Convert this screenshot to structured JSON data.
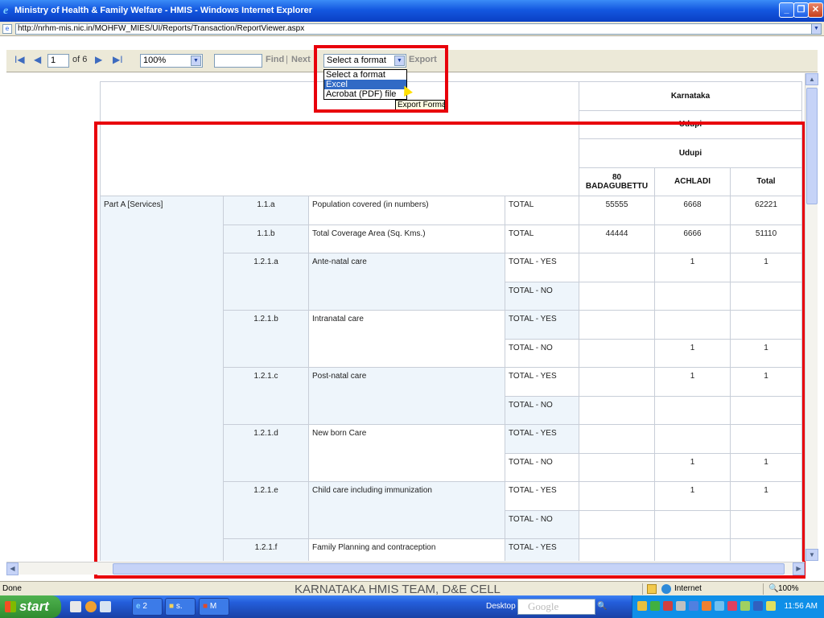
{
  "window": {
    "title": "Ministry of Health & Family Welfare - HMIS - Windows Internet Explorer",
    "url": "http://nrhm-mis.nic.in/MOHFW_MIES/UI/Reports/Transaction/ReportViewer.aspx"
  },
  "toolbar": {
    "first_page": "I◀",
    "prev_page": "◀",
    "page_value": "1",
    "page_of": "of 6",
    "next_page": "▶",
    "last_page": "▶I",
    "zoom": "100%",
    "find_value": "",
    "find_label": "Find",
    "separator": "|",
    "next_label": "Next",
    "format_selected": "Select a format",
    "export_label": "Export"
  },
  "format_dropdown": {
    "options": [
      "Select a format",
      "Excel",
      "Acrobat (PDF) file"
    ],
    "highlighted_index": 1,
    "tooltip": "Export Format"
  },
  "report": {
    "header": {
      "state": "Karnataka",
      "district_row1": "Udupi",
      "district_row2": "Udupi",
      "columns": [
        "80 BADAGUBETTU",
        "ACHLADI",
        "Total"
      ]
    },
    "section_label": "Part A [Services]",
    "rows": [
      {
        "code": "1.1.a",
        "item": "Population covered (in numbers)",
        "type": "TOTAL",
        "v1": "55555",
        "v2": "6668",
        "total": "62221"
      },
      {
        "code": "1.1.b",
        "item": "Total Coverage Area (Sq. Kms.)",
        "type": "TOTAL",
        "v1": "44444",
        "v2": "6666",
        "total": "51110"
      },
      {
        "code": "1.2.1.a",
        "item": "Ante-natal care",
        "type": "TOTAL - YES",
        "v1": "",
        "v2": "1",
        "total": "1"
      },
      {
        "code": "",
        "item": "",
        "type": "TOTAL - NO",
        "v1": "",
        "v2": "",
        "total": ""
      },
      {
        "code": "1.2.1.b",
        "item": "Intranatal care",
        "type": "TOTAL - YES",
        "v1": "",
        "v2": "",
        "total": ""
      },
      {
        "code": "",
        "item": "",
        "type": "TOTAL - NO",
        "v1": "",
        "v2": "1",
        "total": "1"
      },
      {
        "code": "1.2.1.c",
        "item": "Post-natal care",
        "type": "TOTAL - YES",
        "v1": "",
        "v2": "1",
        "total": "1"
      },
      {
        "code": "",
        "item": "",
        "type": "TOTAL - NO",
        "v1": "",
        "v2": "",
        "total": ""
      },
      {
        "code": "1.2.1.d",
        "item": "New born Care",
        "type": "TOTAL - YES",
        "v1": "",
        "v2": "",
        "total": ""
      },
      {
        "code": "",
        "item": "",
        "type": "TOTAL - NO",
        "v1": "",
        "v2": "1",
        "total": "1"
      },
      {
        "code": "1.2.1.e",
        "item": "Child care including immunization",
        "type": "TOTAL - YES",
        "v1": "",
        "v2": "1",
        "total": "1"
      },
      {
        "code": "",
        "item": "",
        "type": "TOTAL - NO",
        "v1": "",
        "v2": "",
        "total": ""
      },
      {
        "code": "1.2.1.f",
        "item": "Family Planning and contraception",
        "type": "TOTAL - YES",
        "v1": "",
        "v2": "",
        "total": ""
      }
    ]
  },
  "statusbar": {
    "status": "Done",
    "zone": "Internet",
    "zoom": "100%",
    "caption": "KARNATAKA HMIS TEAM, D&E CELL"
  },
  "taskbar": {
    "start": "start",
    "ie_group": "2",
    "task1": "s.",
    "task2": "M",
    "desktop": "Desktop",
    "search_placeholder": "Google",
    "clock": "11:56 AM"
  },
  "colors": {
    "highlight": "#e8000b",
    "selection": "#316ac5",
    "cell_tint": "#eef5fb"
  }
}
